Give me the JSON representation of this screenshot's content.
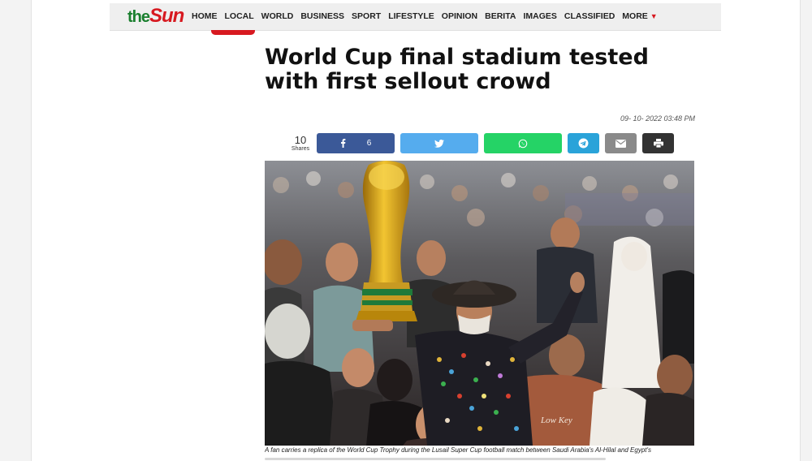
{
  "logo": {
    "part1": "the",
    "part2": "Sun"
  },
  "nav": {
    "items": [
      "HOME",
      "LOCAL",
      "WORLD",
      "BUSINESS",
      "SPORT",
      "LIFESTYLE",
      "OPINION",
      "BERITA",
      "IMAGES",
      "CLASSIFIED"
    ],
    "more_label": "MORE",
    "more_icon": "triangle-down-icon"
  },
  "article": {
    "headline_line1": "World Cup final stadium tested",
    "headline_line2": "with first sellout crowd",
    "timestamp": "09- 10- 2022 03:48 PM"
  },
  "share": {
    "count": "10",
    "count_label": "Shares",
    "facebook_count": "6",
    "icons": [
      "facebook-icon",
      "twitter-icon",
      "whatsapp-icon",
      "telegram-icon",
      "email-icon",
      "print-icon"
    ]
  },
  "colors": {
    "facebook": "#3b5998",
    "twitter": "#55acee",
    "whatsapp": "#25d366",
    "telegram": "#2aa3d9",
    "email": "#8a8a8a",
    "print": "#333333",
    "brand_red": "#d71920",
    "brand_green": "#1a7f2e"
  },
  "photo": {
    "caption": "A fan carries a replica of the World Cup Trophy during the Lusail Super Cup football match between Saudi Arabia's Al-Hilal and Egypt's",
    "shirt_text": "Low Key"
  }
}
